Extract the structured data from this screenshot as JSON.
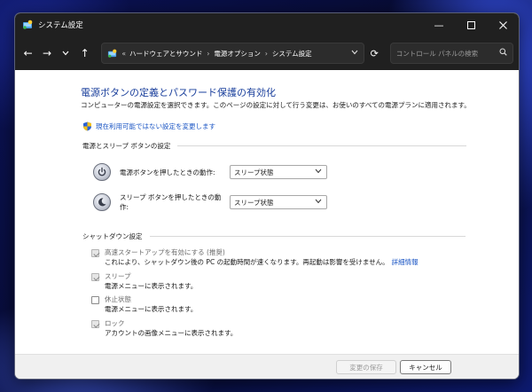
{
  "window": {
    "title": "システム設定"
  },
  "navigation": {
    "breadcrumb_prefix": "«",
    "crumbs": [
      "ハードウェアとサウンド",
      "電源オプション",
      "システム設定"
    ],
    "search_placeholder": "コントロール パネルの検索"
  },
  "main": {
    "heading": "電源ボタンの定義とパスワード保護の有効化",
    "description": "コンピューターの電源設定を選択できます。このページの設定に対して行う変更は、お使いのすべての電源プランに適用されます。",
    "change_settings_link": "現在利用可能ではない設定を変更します"
  },
  "power_section": {
    "title": "電源とスリープ ボタンの設定",
    "rows": [
      {
        "label": "電源ボタンを押したときの動作:",
        "value": "スリープ状態"
      },
      {
        "label": "スリープ ボタンを押したときの動作:",
        "value": "スリープ状態"
      }
    ]
  },
  "shutdown_section": {
    "title": "シャットダウン設定",
    "items": [
      {
        "label": "高速スタートアップを有効にする (推奨)",
        "description": "これにより、シャットダウン後の PC の起動時間が速くなります。再起動は影響を受けません。",
        "link": "詳細情報",
        "checked": true
      },
      {
        "label": "スリープ",
        "description": "電源メニューに表示されます。",
        "checked": true
      },
      {
        "label": "休止状態",
        "description": "電源メニューに表示されます。",
        "checked": false
      },
      {
        "label": "ロック",
        "description": "アカウントの画像メニューに表示されます。",
        "checked": true
      }
    ]
  },
  "footer": {
    "save_label": "変更の保存",
    "cancel_label": "キャンセル"
  },
  "icons": {
    "app": "control-panel-icon",
    "shield": "uac-shield-icon"
  }
}
